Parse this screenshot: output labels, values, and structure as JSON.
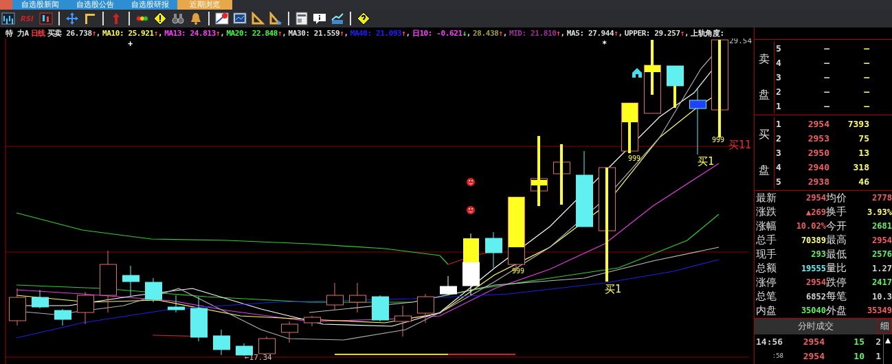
{
  "tabs": [
    {
      "label": "自选股新闻",
      "selected": false
    },
    {
      "label": "自选股公告",
      "selected": false
    },
    {
      "label": "自选股研报",
      "selected": false
    },
    {
      "label": "近期浏览",
      "selected": true
    }
  ],
  "toolbar": {
    "rsi_label": "RSI"
  },
  "indicators": [
    {
      "text": "特  力A",
      "color": "#e0e0e0"
    },
    {
      "text": "日线",
      "color": "#ff4040"
    },
    {
      "text": "买卖 26.738",
      "color": "#e0e0e0",
      "arrow": "↑",
      "kind": "up",
      "sep": ","
    },
    {
      "text": "MA10: 25.921",
      "color": "#ffff40",
      "arrow": "↑",
      "kind": "up",
      "sep": ","
    },
    {
      "text": "MA13: 24.813",
      "color": "#ff40ff",
      "arrow": "↑",
      "kind": "up",
      "sep": ","
    },
    {
      "text": "MA20: 22.848",
      "color": "#40ff40",
      "arrow": "↑",
      "kind": "up",
      "sep": ","
    },
    {
      "text": "MA30: 21.559",
      "color": "#e0e0e0",
      "arrow": "↑",
      "kind": "up",
      "sep": ","
    },
    {
      "text": "MA40: 21.093",
      "color": "#2020ff",
      "arrow": "↑",
      "kind": "up",
      "sep": ","
    },
    {
      "text": "日10: -0.621",
      "color": "#ff40ff",
      "arrow": "↓",
      "kind": "down",
      "sep": ","
    },
    {
      "text": "28.438",
      "color": "#a0a040",
      "arrow": "↑",
      "kind": "up",
      "sep": ","
    },
    {
      "text": "MID: 21.810",
      "color": "#a030a0",
      "arrow": "↑",
      "kind": "up",
      "sep": ","
    },
    {
      "text": "MA5: 27.944",
      "color": "#e0e0e0",
      "arrow": "↑",
      "kind": "up",
      "sep": ","
    },
    {
      "text": "UPPER: 29.257",
      "color": "#e0e0e0",
      "arrow": "↑",
      "kind": "up",
      "sep": ","
    },
    {
      "text": "上轨角度:"
    }
  ],
  "chart": {
    "top_price": "29.54",
    "bottom_price": "←17.34",
    "marks": [
      {
        "kind": "plus",
        "text": "+"
      },
      {
        "kind": "star",
        "text": "*"
      },
      {
        "kind": "signal",
        "text": "999"
      },
      {
        "kind": "signal",
        "text": "999"
      },
      {
        "kind": "signal",
        "text": "999"
      },
      {
        "kind": "buy",
        "text": "买1"
      },
      {
        "kind": "buy",
        "text": "买1"
      },
      {
        "kind": "buy_red",
        "text": "买11"
      }
    ]
  },
  "order_book": {
    "sell_label": [
      "卖",
      "盘"
    ],
    "buy_label": [
      "买",
      "盘"
    ],
    "sell": [
      {
        "rank": "5",
        "price": "—",
        "volume": "—"
      },
      {
        "rank": "4",
        "price": "—",
        "volume": "—"
      },
      {
        "rank": "3",
        "price": "—",
        "volume": "—"
      },
      {
        "rank": "2",
        "price": "—",
        "volume": "—"
      },
      {
        "rank": "1",
        "price": "—",
        "volume": "—"
      }
    ],
    "buy": [
      {
        "rank": "1",
        "price": "2954",
        "volume": "7393"
      },
      {
        "rank": "2",
        "price": "2953",
        "volume": "75"
      },
      {
        "rank": "3",
        "price": "2950",
        "volume": "13"
      },
      {
        "rank": "4",
        "price": "2940",
        "volume": "318"
      },
      {
        "rank": "5",
        "price": "2938",
        "volume": "46"
      }
    ]
  },
  "stats": [
    {
      "label": "最新",
      "value": "2954",
      "color": "#f06060"
    },
    {
      "label": "均价",
      "value": "2778",
      "color": "#f06060"
    },
    {
      "label": "涨跌",
      "value": "▲269",
      "color": "#f06060"
    },
    {
      "label": "换手",
      "value": "3.93%",
      "color": "#ffff60"
    },
    {
      "label": "涨幅",
      "value": "10.02%",
      "color": "#f06060"
    },
    {
      "label": "今开",
      "value": "2681",
      "color": "#60f060"
    },
    {
      "label": "总手",
      "value": "70389",
      "color": "#ffff80"
    },
    {
      "label": "最高",
      "value": "2954",
      "color": "#f06060"
    },
    {
      "label": "现手",
      "value": "293",
      "color": "#60f060"
    },
    {
      "label": "最低",
      "value": "2576",
      "color": "#60f060"
    },
    {
      "label": "总额",
      "value": "19555",
      "color": "#60f0f0"
    },
    {
      "label": "量比",
      "value": "1.27",
      "color": "#d0d0d0"
    },
    {
      "label": "涨停",
      "value": "2954",
      "color": "#f06060"
    },
    {
      "label": "跌停",
      "value": "2417",
      "color": "#60f060"
    },
    {
      "label": "总笔",
      "value": "6852",
      "color": "#d0d0d0"
    },
    {
      "label": "每笔",
      "value": "10.3",
      "color": "#d0d0d0"
    },
    {
      "label": "内盘",
      "value": "35040",
      "color": "#60f060"
    },
    {
      "label": "外盘",
      "value": "35349",
      "color": "#f06060"
    }
  ],
  "trades": {
    "title": "分时成交",
    "detail_button": "细",
    "rows": [
      {
        "time": "14:56",
        "price": "2954",
        "volume": "15",
        "count": "2"
      },
      {
        "time": ":58",
        "price": "2954",
        "volume": "10",
        "count": "1"
      }
    ]
  }
}
